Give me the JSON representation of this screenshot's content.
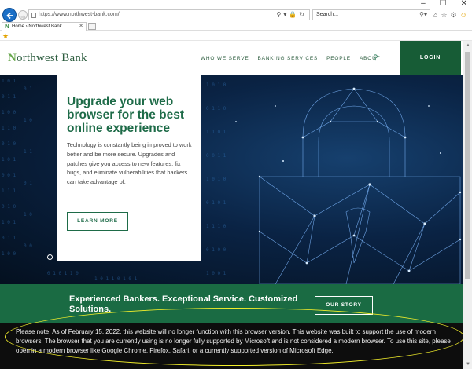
{
  "browser": {
    "window_controls": [
      "–",
      "☐",
      "✕"
    ],
    "url": "https://www.northwest-bank.com/",
    "search_placeholder": "Search...",
    "tab_title": "Home › Northwest Bank",
    "tab_favicon": "N"
  },
  "header": {
    "logo_prefix": "N",
    "logo_rest": "orthwest Bank",
    "nav": [
      "WHO WE SERVE",
      "BANKING SERVICES",
      "PEOPLE",
      "ABOUT"
    ],
    "login_label": "LOGIN"
  },
  "hero": {
    "headline": "Upgrade your web browser for the best online experience",
    "body": "Technology is constantly being improved to work better and be more secure. Upgrades and patches give you access to new features, fix bugs, and eliminate vulnerabilities that hackers can take advantage of.",
    "button_label": "LEARN MORE",
    "slide_count": 4,
    "active_slide": 1
  },
  "band": {
    "tagline": "Experienced Bankers. Exceptional Service. Customized Solutions.",
    "button_label": "OUR STORY"
  },
  "notice": {
    "text": "Please note: As of February 15, 2022, this website will no longer function with this browser version. This website was built to support the use of modern browsers. The browser that you are currently using is no longer fully supported by Microsoft and is not considered a modern browser. To use this site, please open in a modern browser like Google Chrome, Firefox, Safari, or a currently supported version of Microsoft Edge."
  },
  "colors": {
    "brand_green": "#175c36",
    "band_green": "#1a6b43",
    "headline_green": "#1e6b48",
    "highlight_yellow": "#f2ee2b",
    "ie_blue": "#1a6fc7"
  },
  "icons": [
    "back-icon",
    "forward-icon",
    "page-icon",
    "search-icon",
    "lock-icon",
    "refresh-icon",
    "home-icon",
    "star-icon",
    "gear-icon",
    "smiley-icon",
    "favorites-star-icon",
    "close-icon"
  ]
}
